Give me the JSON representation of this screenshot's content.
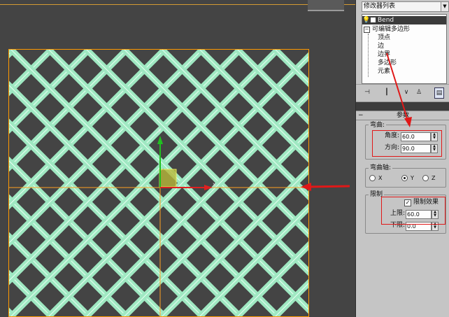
{
  "modifier_panel": {
    "dropdown_label": "修改器列表",
    "stack": {
      "bend_label": "Bend",
      "editable_poly_label": "可编辑多边形",
      "sub_objects": [
        "顶点",
        "边",
        "边界",
        "多边形",
        "元素"
      ]
    }
  },
  "parameters": {
    "rollout_title": "参数",
    "bend_group": {
      "title": "弯曲:",
      "angle_label": "角度:",
      "angle_value": "60.0",
      "direction_label": "方向:",
      "direction_value": "90.0"
    },
    "axis_group": {
      "title": "弯曲轴:",
      "options": [
        "X",
        "Y",
        "Z"
      ],
      "selected": "Y"
    },
    "limits_group": {
      "title": "限制",
      "limit_effect_label": "限制效果",
      "limit_effect_checked": true,
      "upper_label": "上限:",
      "upper_value": "60.0",
      "lower_label": "下限:",
      "lower_value": "0.0"
    }
  },
  "viewport": {
    "gizmo_x_label": "x",
    "gizmo_y_label": "y",
    "mesh_color": "#9fe8c2",
    "selection_color": "#ff9900"
  },
  "annotations": {
    "arrow_color": "#e01818"
  }
}
